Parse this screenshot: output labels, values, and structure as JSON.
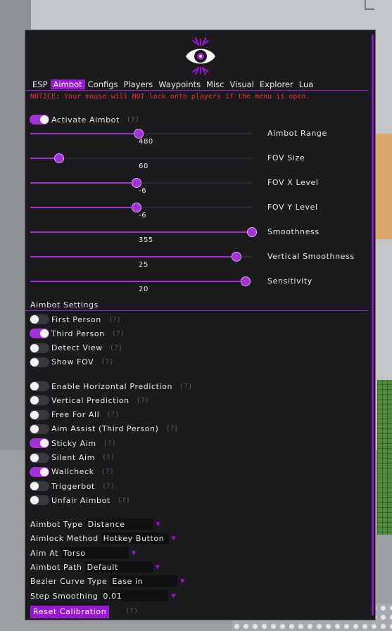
{
  "tabs": [
    "ESP",
    "Aimbot",
    "Configs",
    "Players",
    "Waypoints",
    "Misc",
    "Visual",
    "Explorer",
    "Lua"
  ],
  "active_tab": "Aimbot",
  "notice": "NOTICE: Your mouse will NOT lock onto players if the menu is open.",
  "help_mark": "(?)",
  "activate": {
    "label": "Activate Aimbot",
    "on": true
  },
  "sliders": [
    {
      "name": "Aimbot Range",
      "value": "480",
      "fraction": 0.49
    },
    {
      "name": "FOV Size",
      "value": "60",
      "fraction": 0.13
    },
    {
      "name": "FOV X Level",
      "value": "-6",
      "fraction": 0.48
    },
    {
      "name": "FOV Y Level",
      "value": "-6",
      "fraction": 0.48
    },
    {
      "name": "Smoothness",
      "value": "355",
      "fraction": 1.0
    },
    {
      "name": "Vertical Smoothness",
      "value": "25",
      "fraction": 0.93
    },
    {
      "name": "Sensitivity",
      "value": "20",
      "fraction": 0.97
    }
  ],
  "settings_title": "Aimbot Settings",
  "toggles_a": [
    {
      "label": "First Person",
      "on": false
    },
    {
      "label": "Third Person",
      "on": true
    },
    {
      "label": "Detect View",
      "on": false
    },
    {
      "label": "Show FOV",
      "on": false
    }
  ],
  "toggles_b": [
    {
      "label": "Enable Horizontal Prediction",
      "on": false
    },
    {
      "label": "Vertical Prediction",
      "on": false
    },
    {
      "label": "Free For All",
      "on": false
    },
    {
      "label": "Aim Assist (Third Person)",
      "on": false
    },
    {
      "label": "Sticky Aim",
      "on": true
    },
    {
      "label": "Silent Aim",
      "on": false
    },
    {
      "label": "Wallcheck",
      "on": true
    },
    {
      "label": "Triggerbot",
      "on": false
    },
    {
      "label": "Unfair Aimbot",
      "on": false
    }
  ],
  "dropdowns": [
    {
      "label": "Aimbot Type",
      "value": "Distance"
    },
    {
      "label": "Aimlock Method",
      "value": "Hotkey Button"
    },
    {
      "label": "Aim At",
      "value": "Torso"
    },
    {
      "label": "Aimbot Path",
      "value": "Default"
    },
    {
      "label": "Bezier Curve Type",
      "value": "Ease in"
    },
    {
      "label": "Step Smoothing",
      "value": "0.01"
    }
  ],
  "reset_label": "Reset Calibration",
  "colors": {
    "accent": "#9b17d6",
    "notice": "#e2333a",
    "panel": "#1b1b1d"
  },
  "icons": {
    "logo": "eye-logo-icon",
    "dropdown": "triangle-down-icon"
  }
}
